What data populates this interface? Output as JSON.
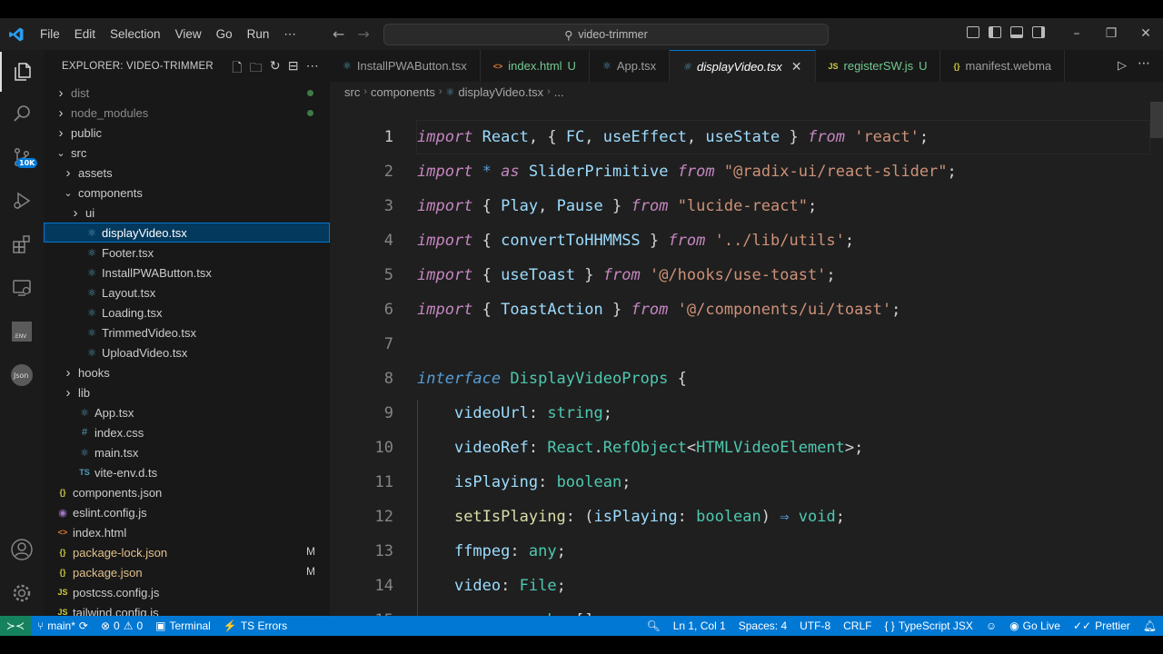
{
  "titlebar": {
    "menu": [
      "File",
      "Edit",
      "Selection",
      "View",
      "Go",
      "Run",
      "⋯"
    ],
    "search_text": "video-trimmer"
  },
  "activity": {
    "source_control_badge": "10K"
  },
  "explorer": {
    "title": "EXPLORER: VIDEO-TRIMMER",
    "items": [
      {
        "name": "dist",
        "kind": "folder",
        "depth": 0,
        "open": false,
        "dot": true
      },
      {
        "name": "node_modules",
        "kind": "folder",
        "depth": 0,
        "open": false,
        "dot": true
      },
      {
        "name": "public",
        "kind": "folder",
        "depth": 0,
        "open": false
      },
      {
        "name": "src",
        "kind": "folder",
        "depth": 0,
        "open": true
      },
      {
        "name": "assets",
        "kind": "folder",
        "depth": 1,
        "open": false
      },
      {
        "name": "components",
        "kind": "folder",
        "depth": 1,
        "open": true
      },
      {
        "name": "ui",
        "kind": "folder",
        "depth": 2,
        "open": false
      },
      {
        "name": "displayVideo.tsx",
        "kind": "tsx",
        "depth": 2,
        "selected": true
      },
      {
        "name": "Footer.tsx",
        "kind": "tsx",
        "depth": 2
      },
      {
        "name": "InstallPWAButton.tsx",
        "kind": "tsx",
        "depth": 2
      },
      {
        "name": "Layout.tsx",
        "kind": "tsx",
        "depth": 2
      },
      {
        "name": "Loading.tsx",
        "kind": "tsx",
        "depth": 2
      },
      {
        "name": "TrimmedVideo.tsx",
        "kind": "tsx",
        "depth": 2
      },
      {
        "name": "UploadVideo.tsx",
        "kind": "tsx",
        "depth": 2
      },
      {
        "name": "hooks",
        "kind": "folder",
        "depth": 1,
        "open": false
      },
      {
        "name": "lib",
        "kind": "folder",
        "depth": 1,
        "open": false
      },
      {
        "name": "App.tsx",
        "kind": "tsx",
        "depth": 1
      },
      {
        "name": "index.css",
        "kind": "css",
        "depth": 1
      },
      {
        "name": "main.tsx",
        "kind": "tsx",
        "depth": 1
      },
      {
        "name": "vite-env.d.ts",
        "kind": "ts",
        "depth": 1
      },
      {
        "name": "components.json",
        "kind": "json",
        "depth": 0
      },
      {
        "name": "eslint.config.js",
        "kind": "eslint",
        "depth": 0
      },
      {
        "name": "index.html",
        "kind": "html",
        "depth": 0
      },
      {
        "name": "package-lock.json",
        "kind": "json",
        "depth": 0,
        "git": "M"
      },
      {
        "name": "package.json",
        "kind": "json",
        "depth": 0,
        "git": "M"
      },
      {
        "name": "postcss.config.js",
        "kind": "js",
        "depth": 0
      },
      {
        "name": "tailwind.config.js",
        "kind": "js",
        "depth": 0
      }
    ]
  },
  "tabs": [
    {
      "name": "InstallPWAButton.tsx",
      "kind": "tsx"
    },
    {
      "name": "index.html",
      "kind": "html",
      "badge": "U"
    },
    {
      "name": "App.tsx",
      "kind": "tsx"
    },
    {
      "name": "displayVideo.tsx",
      "kind": "tsx",
      "active": true
    },
    {
      "name": "registerSW.js",
      "kind": "js",
      "badge": "U"
    },
    {
      "name": "manifest.webma",
      "kind": "json"
    }
  ],
  "breadcrumb": [
    "src",
    "components",
    "displayVideo.tsx",
    "..."
  ],
  "code": [
    [
      [
        "kw",
        "import"
      ],
      [
        "pun",
        " "
      ],
      [
        "id",
        "React"
      ],
      [
        "pun",
        ", { "
      ],
      [
        "id",
        "FC"
      ],
      [
        "pun",
        ", "
      ],
      [
        "id",
        "useEffect"
      ],
      [
        "pun",
        ", "
      ],
      [
        "id",
        "useState"
      ],
      [
        "pun",
        " } "
      ],
      [
        "kw",
        "from"
      ],
      [
        "pun",
        " "
      ],
      [
        "str",
        "'react'"
      ],
      [
        "pun",
        ";"
      ]
    ],
    [
      [
        "kw",
        "import"
      ],
      [
        "pun",
        " "
      ],
      [
        "arr",
        "*"
      ],
      [
        "pun",
        " "
      ],
      [
        "kw",
        "as"
      ],
      [
        "pun",
        " "
      ],
      [
        "id",
        "SliderPrimitive"
      ],
      [
        "pun",
        " "
      ],
      [
        "kw",
        "from"
      ],
      [
        "pun",
        " "
      ],
      [
        "str",
        "\"@radix-ui/react-slider\""
      ],
      [
        "pun",
        ";"
      ]
    ],
    [
      [
        "kw",
        "import"
      ],
      [
        "pun",
        " { "
      ],
      [
        "id",
        "Play"
      ],
      [
        "pun",
        ", "
      ],
      [
        "id",
        "Pause"
      ],
      [
        "pun",
        " } "
      ],
      [
        "kw",
        "from"
      ],
      [
        "pun",
        " "
      ],
      [
        "str",
        "\"lucide-react\""
      ],
      [
        "pun",
        ";"
      ]
    ],
    [
      [
        "kw",
        "import"
      ],
      [
        "pun",
        " { "
      ],
      [
        "id",
        "convertToHHMMSS"
      ],
      [
        "pun",
        " } "
      ],
      [
        "kw",
        "from"
      ],
      [
        "pun",
        " "
      ],
      [
        "str",
        "'../lib/utils'"
      ],
      [
        "pun",
        ";"
      ]
    ],
    [
      [
        "kw",
        "import"
      ],
      [
        "pun",
        " { "
      ],
      [
        "id",
        "useToast"
      ],
      [
        "pun",
        " } "
      ],
      [
        "kw",
        "from"
      ],
      [
        "pun",
        " "
      ],
      [
        "str",
        "'@/hooks/use-toast'"
      ],
      [
        "pun",
        ";"
      ]
    ],
    [
      [
        "kw",
        "import"
      ],
      [
        "pun",
        " { "
      ],
      [
        "id",
        "ToastAction"
      ],
      [
        "pun",
        " } "
      ],
      [
        "kw",
        "from"
      ],
      [
        "pun",
        " "
      ],
      [
        "str",
        "'@/components/ui/toast'"
      ],
      [
        "pun",
        ";"
      ]
    ],
    [],
    [
      [
        "kw2",
        "interface"
      ],
      [
        "pun",
        " "
      ],
      [
        "ty",
        "DisplayVideoProps"
      ],
      [
        "pun",
        " {"
      ]
    ],
    [
      [
        "pun",
        "    "
      ],
      [
        "prop",
        "videoUrl"
      ],
      [
        "pun",
        ": "
      ],
      [
        "ty",
        "string"
      ],
      [
        "pun",
        ";"
      ]
    ],
    [
      [
        "pun",
        "    "
      ],
      [
        "prop",
        "videoRef"
      ],
      [
        "pun",
        ": "
      ],
      [
        "ty",
        "React"
      ],
      [
        "pun",
        "."
      ],
      [
        "ty",
        "RefObject"
      ],
      [
        "pun",
        "<"
      ],
      [
        "ty",
        "HTMLVideoElement"
      ],
      [
        "pun",
        ">;"
      ]
    ],
    [
      [
        "pun",
        "    "
      ],
      [
        "prop",
        "isPlaying"
      ],
      [
        "pun",
        ": "
      ],
      [
        "ty",
        "boolean"
      ],
      [
        "pun",
        ";"
      ]
    ],
    [
      [
        "pun",
        "    "
      ],
      [
        "fn",
        "setIsPlaying"
      ],
      [
        "pun",
        ": ("
      ],
      [
        "prop",
        "isPlaying"
      ],
      [
        "pun",
        ": "
      ],
      [
        "ty",
        "boolean"
      ],
      [
        "pun",
        ") "
      ],
      [
        "arr",
        "⇒"
      ],
      [
        "pun",
        " "
      ],
      [
        "ty",
        "void"
      ],
      [
        "pun",
        ";"
      ]
    ],
    [
      [
        "pun",
        "    "
      ],
      [
        "prop",
        "ffmpeg"
      ],
      [
        "pun",
        ": "
      ],
      [
        "ty",
        "any"
      ],
      [
        "pun",
        ";"
      ]
    ],
    [
      [
        "pun",
        "    "
      ],
      [
        "prop",
        "video"
      ],
      [
        "pun",
        ": "
      ],
      [
        "ty",
        "File"
      ],
      [
        "pun",
        ";"
      ]
    ],
    [
      [
        "pun",
        "    "
      ],
      [
        "prop",
        "range"
      ],
      [
        "pun",
        ": "
      ],
      [
        "ty",
        "number"
      ],
      [
        "pun",
        "[];"
      ]
    ]
  ],
  "status": {
    "branch": "main*",
    "errors": "0",
    "warnings": "0",
    "terminal": "Terminal",
    "ts_errors": "TS Errors",
    "position": "Ln 1, Col 1",
    "spaces": "Spaces: 4",
    "encoding": "UTF-8",
    "eol": "CRLF",
    "language": "TypeScript JSX",
    "golive": "Go Live",
    "prettier": "Prettier"
  },
  "colors": {
    "accent": "#0078d4",
    "statusbar": "#0078d4",
    "tsx_icon": "#519aba",
    "json_icon": "#cbcb41",
    "js_icon": "#cbcb41",
    "html_icon": "#e37933",
    "css_icon": "#519aba",
    "eslint_icon": "#a074c4"
  }
}
